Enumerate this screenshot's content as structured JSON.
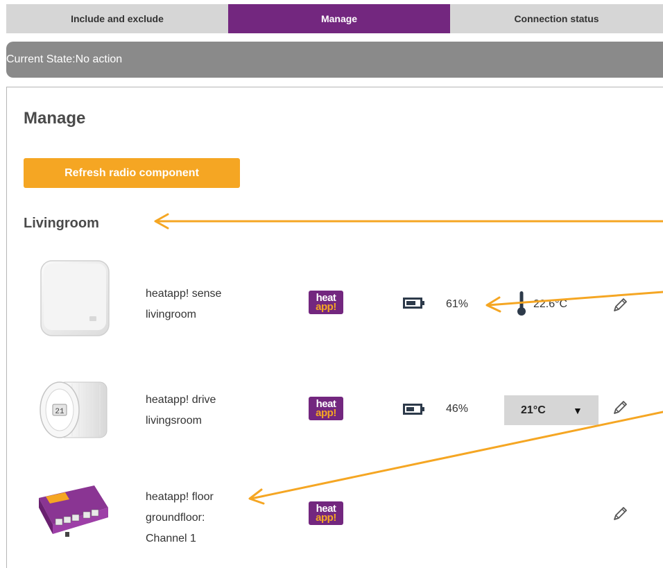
{
  "tabs": [
    {
      "label": "Include and exclude"
    },
    {
      "label": "Manage"
    },
    {
      "label": "Connection status"
    }
  ],
  "state": {
    "label": "Current State:",
    "value": "No action"
  },
  "page": {
    "title": "Manage",
    "refresh_label": "Refresh radio component"
  },
  "room": {
    "name": "Livingroom"
  },
  "devices": [
    {
      "name_line1": "heatapp! sense",
      "name_line2": "livingroom",
      "logo_top": "heat",
      "logo_bottom": "app!",
      "battery": "61%",
      "temperature": "22.6°C"
    },
    {
      "name_line1": "heatapp! drive",
      "name_line2": "livingsroom",
      "logo_top": "heat",
      "logo_bottom": "app!",
      "battery": "46%",
      "setpoint": "21°C"
    },
    {
      "name_line1": "heatapp! floor",
      "name_line2": "groundfloor:",
      "name_line3": "Channel 1",
      "logo_top": "heat",
      "logo_bottom": "app!"
    }
  ],
  "colors": {
    "accent_purple": "#73277f",
    "accent_orange": "#f5a623",
    "state_bar": "#8a8a8a",
    "tab_gray": "#d6d6d6"
  },
  "icons": [
    "battery-icon",
    "thermometer-icon",
    "pencil-icon",
    "dropdown-caret-icon"
  ]
}
